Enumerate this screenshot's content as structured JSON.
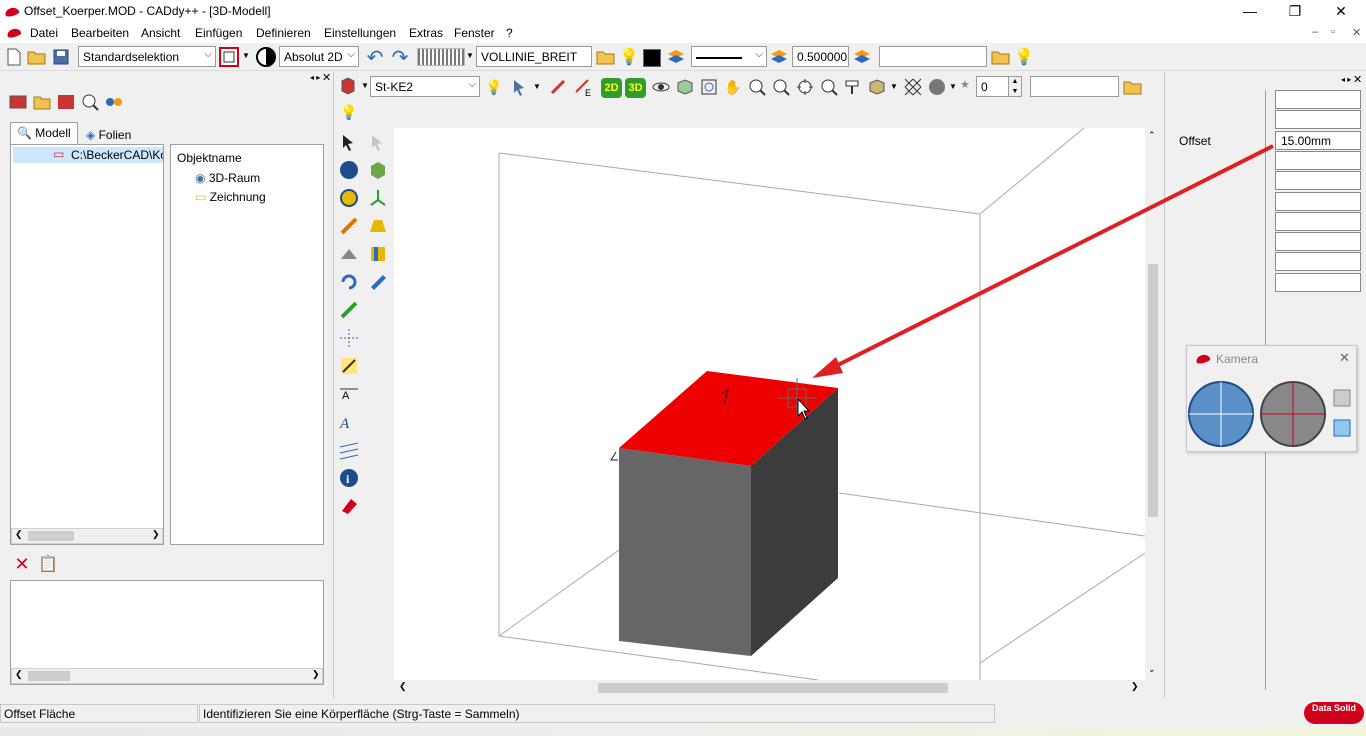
{
  "window": {
    "title": "Offset_Koerper.MOD  -  CADdy++ - [3D-Modell]",
    "minimize": "—",
    "maximize": "❐",
    "close": "✕",
    "mdi_min": "–",
    "mdi_restore": "▫",
    "mdi_close": "✕"
  },
  "menu": [
    "Datei",
    "Bearbeiten",
    "Ansicht",
    "Einfügen",
    "Definieren",
    "Einstellungen",
    "Extras",
    "Fenster",
    "?"
  ],
  "toolbar1": {
    "selection_mode": "Standardselektion",
    "coord_mode": "Absolut 2D",
    "linetype": "VOLLINIE_BREIT",
    "line_width": "0.500000",
    "layer_field": ""
  },
  "toolbar2": {
    "material": "St-KE2",
    "layer_number": "0",
    "search_field": "",
    "btn_2d": "2D",
    "btn_3d": "3D"
  },
  "left_panel": {
    "tabs": [
      "Modell",
      "Folien"
    ],
    "tree_root": "C:\\BeckerCAD\\Ko",
    "object_header": "Objektname",
    "objects": [
      "3D-Raum",
      "Zeichnung"
    ]
  },
  "properties": {
    "offset_label": "Offset",
    "offset_value": "15.00mm"
  },
  "camera": {
    "title": "Kamera"
  },
  "status": {
    "command": "Offset Fläche",
    "prompt": "Identifizieren Sie eine Körperfläche (Strg-Taste = Sammeln)",
    "brand": "Data Solid"
  },
  "colors": {
    "accent": "#d0021b",
    "face_top": "#ee0000",
    "face_front": "#666666",
    "face_side": "#3c3c3c"
  }
}
